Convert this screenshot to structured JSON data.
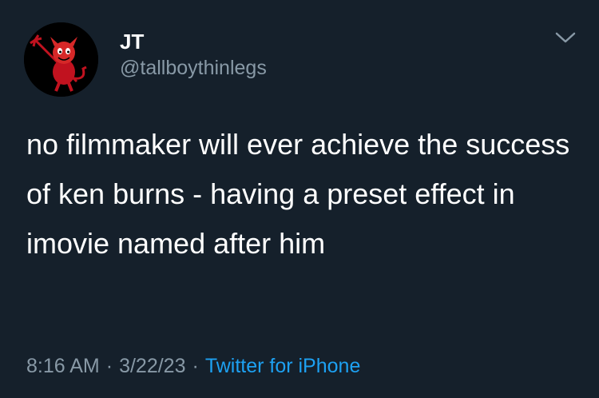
{
  "author": {
    "display_name": "JT",
    "handle": "@tallboythinlegs",
    "avatar_icon": "red-devil-cartoon"
  },
  "tweet": {
    "text": "no filmmaker will ever achieve the success of ken burns - having a preset effect in imovie named after him",
    "time": "8:16 AM",
    "date": "3/22/23",
    "separator": "·",
    "source": "Twitter for iPhone"
  },
  "menu_icon": "chevron-down-icon",
  "colors": {
    "background": "#15202b",
    "primary_text": "#ffffff",
    "secondary_text": "#8899a6",
    "link": "#1da1f2"
  }
}
